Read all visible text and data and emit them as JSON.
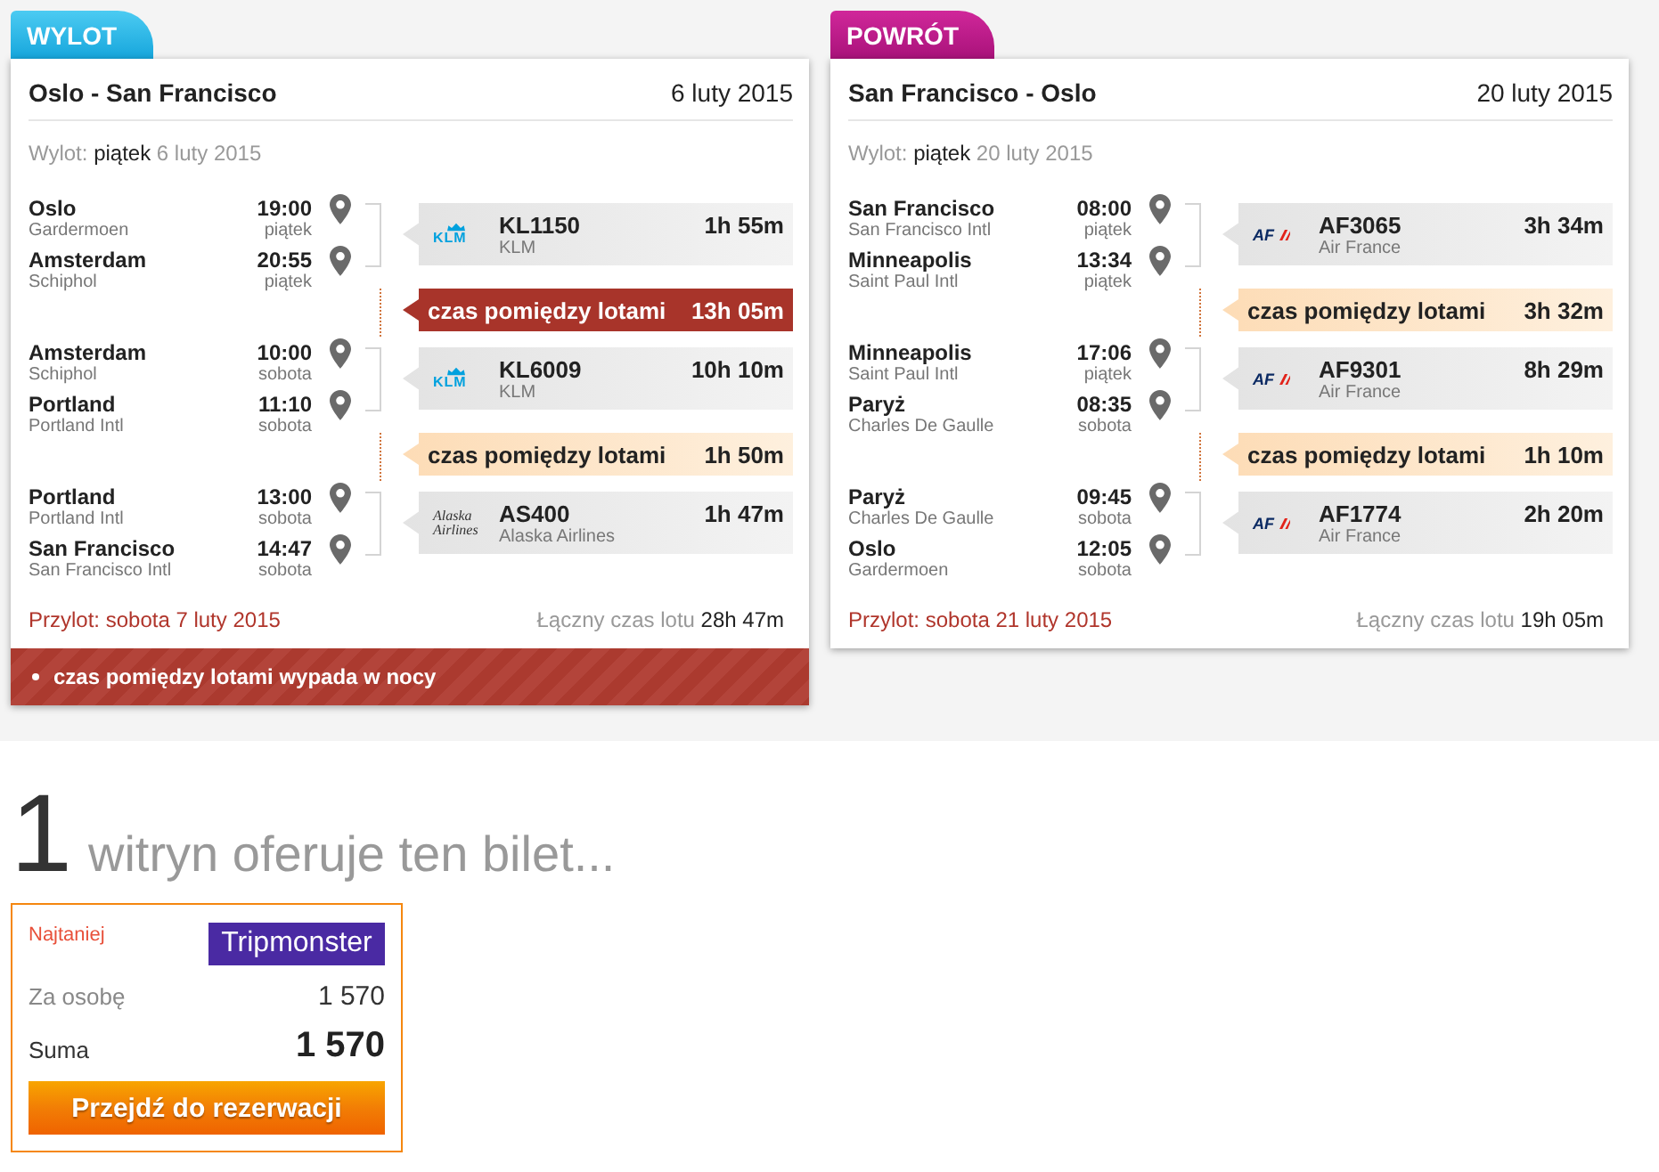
{
  "cards": [
    {
      "tab": "WYLOT",
      "kind": "outbound",
      "route": "Oslo - San Francisco",
      "date": "6 luty 2015",
      "departure": {
        "label": "Wylot:",
        "weekday": "piątek",
        "date": "6 luty 2015"
      },
      "segments": [
        {
          "kind": "flight",
          "stops": [
            {
              "city": "Oslo",
              "airport": "Gardermoen",
              "time": "19:00",
              "day": "piątek"
            },
            {
              "city": "Amsterdam",
              "airport": "Schiphol",
              "time": "20:55",
              "day": "piątek"
            }
          ],
          "logo": {
            "kind": "crown",
            "text": "KLM"
          },
          "flight_number": "KL1150",
          "airline": "KLM",
          "duration": "1h 55m"
        },
        {
          "kind": "layover",
          "label": "czas pomiędzy lotami",
          "duration": "13h 05m",
          "night": true
        },
        {
          "kind": "flight",
          "stops": [
            {
              "city": "Amsterdam",
              "airport": "Schiphol",
              "time": "10:00",
              "day": "sobota"
            },
            {
              "city": "Portland",
              "airport": "Portland Intl",
              "time": "11:10",
              "day": "sobota"
            }
          ],
          "logo": {
            "kind": "crown",
            "text": "KLM"
          },
          "flight_number": "KL6009",
          "airline": "KLM",
          "duration": "10h 10m"
        },
        {
          "kind": "layover",
          "label": "czas pomiędzy lotami",
          "duration": "1h 50m",
          "night": false
        },
        {
          "kind": "flight",
          "stops": [
            {
              "city": "Portland",
              "airport": "Portland Intl",
              "time": "13:00",
              "day": "sobota"
            },
            {
              "city": "San Francisco",
              "airport": "San Francisco Intl",
              "time": "14:47",
              "day": "sobota"
            }
          ],
          "logo": {
            "kind": "script",
            "text": "Alaska Airlines"
          },
          "flight_number": "AS400",
          "airline": "Alaska Airlines",
          "duration": "1h 47m"
        }
      ],
      "arrival": "Przylot: sobota 7 luty 2015",
      "total": {
        "label": "Łączny czas lotu",
        "value": "28h 47m"
      },
      "notes": [
        "czas pomiędzy lotami wypada w nocy"
      ]
    },
    {
      "tab": "POWRÓT",
      "kind": "return",
      "route": "San Francisco - Oslo",
      "date": "20 luty 2015",
      "departure": {
        "label": "Wylot:",
        "weekday": "piątek",
        "date": "20 luty 2015"
      },
      "segments": [
        {
          "kind": "flight",
          "stops": [
            {
              "city": "San Francisco",
              "airport": "San Francisco Intl",
              "time": "08:00",
              "day": "piątek"
            },
            {
              "city": "Minneapolis",
              "airport": "Saint Paul Intl",
              "time": "13:34",
              "day": "piątek"
            }
          ],
          "logo": {
            "kind": "stripes",
            "text": "AF"
          },
          "flight_number": "AF3065",
          "airline": "Air France",
          "duration": "3h 34m"
        },
        {
          "kind": "layover",
          "label": "czas pomiędzy lotami",
          "duration": "3h 32m",
          "night": false
        },
        {
          "kind": "flight",
          "stops": [
            {
              "city": "Minneapolis",
              "airport": "Saint Paul Intl",
              "time": "17:06",
              "day": "piątek"
            },
            {
              "city": "Paryż",
              "airport": "Charles De Gaulle",
              "time": "08:35",
              "day": "sobota"
            }
          ],
          "logo": {
            "kind": "stripes",
            "text": "AF"
          },
          "flight_number": "AF9301",
          "airline": "Air France",
          "duration": "8h 29m"
        },
        {
          "kind": "layover",
          "label": "czas pomiędzy lotami",
          "duration": "1h 10m",
          "night": false
        },
        {
          "kind": "flight",
          "stops": [
            {
              "city": "Paryż",
              "airport": "Charles De Gaulle",
              "time": "09:45",
              "day": "sobota"
            },
            {
              "city": "Oslo",
              "airport": "Gardermoen",
              "time": "12:05",
              "day": "sobota"
            }
          ],
          "logo": {
            "kind": "stripes",
            "text": "AF"
          },
          "flight_number": "AF1774",
          "airline": "Air France",
          "duration": "2h 20m"
        }
      ],
      "arrival": "Przylot: sobota 21 luty 2015",
      "total": {
        "label": "Łączny czas lotu",
        "value": "19h 05m"
      }
    }
  ],
  "offers": {
    "count": "1",
    "heading": "witryn oferuje ten bilet...",
    "items": [
      {
        "badge": "Najtaniej",
        "site": "Tripmonster",
        "per_person_label": "Za osobę",
        "per_person": "1 570",
        "total_label": "Suma",
        "total": "1 570",
        "button": "Przejdź do rezerwacji"
      }
    ]
  }
}
